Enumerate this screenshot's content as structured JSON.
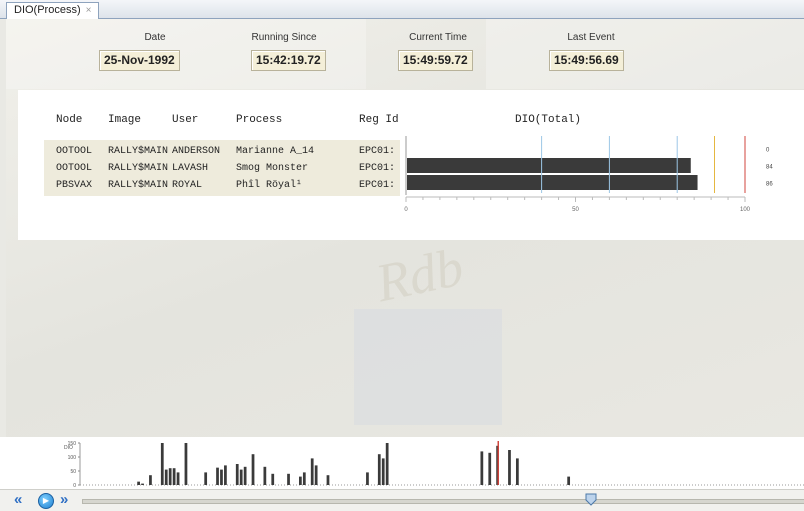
{
  "tab": {
    "label": "DIO(Process)",
    "close": "×"
  },
  "header": {
    "date_label": "Date",
    "date_value": "25-Nov-1992",
    "running_label": "Running Since",
    "running_value": "15:42:19.72",
    "current_label": "Current Time",
    "current_value": "15:49:59.72",
    "last_label": "Last Event",
    "last_value": "15:49:56.69"
  },
  "table": {
    "columns": [
      "Node",
      "Image",
      "User",
      "Process",
      "Reg Id",
      "DIO(Total)"
    ],
    "rows": [
      {
        "node": "OOTOOL",
        "image": "RALLY$MAIN",
        "user": "ANDERSON",
        "process": "Marianne A_14",
        "regid": "EPC01:"
      },
      {
        "node": "OOTOOL",
        "image": "RALLY$MAIN",
        "user": "LAVASH",
        "process": "Smog Monster",
        "regid": "EPC01:"
      },
      {
        "node": "PBSVAX",
        "image": "RALLY$MAIN",
        "user": "ROYAL",
        "process": "Phîl Röyal¹",
        "regid": "EPC01:"
      }
    ]
  },
  "chart_data": {
    "type": "bar",
    "orientation": "horizontal",
    "title": "DIO(Total)",
    "categories": [
      "Marianne A_14",
      "Smog Monster",
      "Phîl Röyal¹"
    ],
    "values": [
      0,
      84,
      86
    ],
    "value_labels": [
      "0",
      "84",
      "86"
    ],
    "xlim": [
      0,
      100
    ],
    "xticks": [
      "0",
      "50",
      "100"
    ],
    "threshold_lines": [
      {
        "value": 40,
        "color": "#9cc6e6"
      },
      {
        "value": 60,
        "color": "#9cc6e6"
      },
      {
        "value": 80,
        "color": "#9cc6e6"
      },
      {
        "value": 91,
        "color": "#e5b740"
      },
      {
        "value": 100,
        "color": "#d0453c"
      }
    ],
    "bar_color": "#3a3a3a"
  },
  "history": {
    "ylabel": "DIO",
    "yticks": [
      "150",
      "100",
      "50",
      "0"
    ],
    "ymax": 150,
    "bar_color": "#3a3a3a",
    "marker_color": "#d0453c",
    "marker_index": 105,
    "values": [
      0,
      0,
      0,
      0,
      0,
      0,
      0,
      0,
      0,
      0,
      0,
      0,
      0,
      0,
      12,
      5,
      0,
      35,
      0,
      0,
      150,
      55,
      60,
      60,
      45,
      0,
      150,
      0,
      0,
      0,
      0,
      45,
      0,
      0,
      62,
      55,
      70,
      0,
      0,
      75,
      55,
      65,
      0,
      110,
      0,
      0,
      65,
      0,
      40,
      0,
      0,
      0,
      40,
      0,
      0,
      30,
      45,
      0,
      95,
      70,
      0,
      0,
      35,
      0,
      0,
      0,
      0,
      0,
      0,
      0,
      0,
      0,
      45,
      0,
      0,
      110,
      95,
      150,
      0,
      0,
      0,
      0,
      0,
      0,
      0,
      0,
      0,
      0,
      0,
      0,
      0,
      0,
      0,
      0,
      0,
      0,
      0,
      0,
      0,
      0,
      0,
      120,
      0,
      115,
      0,
      140,
      0,
      0,
      125,
      0,
      95,
      0,
      0,
      0,
      0,
      0,
      0,
      0,
      0,
      0,
      0,
      0,
      0,
      30,
      0,
      0,
      0,
      0,
      0,
      0,
      0,
      0,
      0,
      0,
      0,
      0,
      0,
      0,
      0,
      0,
      0,
      0,
      0,
      0,
      0,
      0,
      0,
      0,
      0,
      0,
      0,
      0,
      0,
      0,
      0,
      0,
      0,
      0,
      0,
      0,
      0,
      0,
      0,
      0,
      0,
      0,
      0,
      0,
      0,
      0,
      0,
      0,
      0,
      0,
      0,
      0,
      0,
      0,
      0,
      0,
      0,
      0,
      0
    ]
  },
  "navigation": {
    "rewind": "«",
    "play": "▶",
    "forward": "»",
    "position": 0.705
  },
  "watermark": "Rdb"
}
